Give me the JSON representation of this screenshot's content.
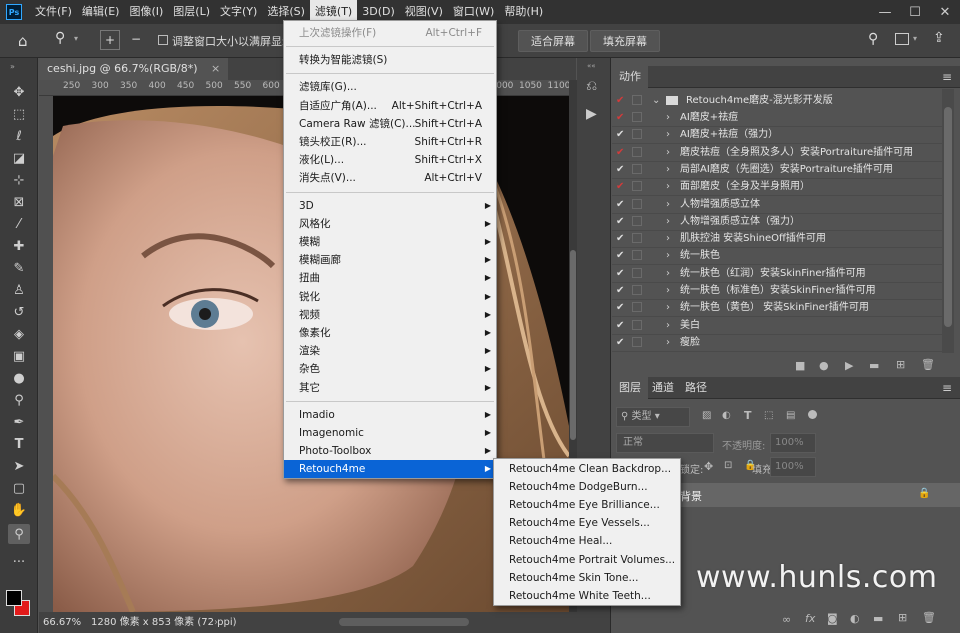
{
  "menubar": {
    "items": [
      "文件(F)",
      "编辑(E)",
      "图像(I)",
      "图层(L)",
      "文字(Y)",
      "选择(S)",
      "滤镜(T)",
      "3D(D)",
      "视图(V)",
      "窗口(W)",
      "帮助(H)"
    ],
    "active_index": 6
  },
  "window": {
    "min": "—",
    "max": "☐",
    "close": "✕"
  },
  "options": {
    "resize_label": "调整窗口大小以满屏显示",
    "fit_label": "适合屏幕",
    "fill_label": "填充屏幕"
  },
  "document": {
    "tab": "ceshi.jpg @ 66.7%(RGB/8*)",
    "close": "×"
  },
  "ruler": [
    "250",
    "300",
    "350",
    "400",
    "450",
    "500",
    "550",
    "600",
    "650",
    "700",
    "750",
    "800",
    "850",
    "900",
    "950",
    "1000",
    "1050",
    "1100"
  ],
  "status": {
    "zoom": "66.67%",
    "info": "1280 像素 x 853 像素 (72 ppi)"
  },
  "filter_menu": {
    "items": [
      {
        "label": "上次滤镜操作(F)",
        "shortcut": "Alt+Ctrl+F",
        "disabled": true
      },
      {
        "sep": true
      },
      {
        "label": "转换为智能滤镜(S)"
      },
      {
        "sep": true
      },
      {
        "label": "滤镜库(G)..."
      },
      {
        "label": "自适应广角(A)...",
        "shortcut": "Alt+Shift+Ctrl+A"
      },
      {
        "label": "Camera Raw 滤镜(C)...",
        "shortcut": "Shift+Ctrl+A"
      },
      {
        "label": "镜头校正(R)...",
        "shortcut": "Shift+Ctrl+R"
      },
      {
        "label": "液化(L)...",
        "shortcut": "Shift+Ctrl+X"
      },
      {
        "label": "消失点(V)...",
        "shortcut": "Alt+Ctrl+V"
      },
      {
        "sep": true
      },
      {
        "label": "3D",
        "arrow": true
      },
      {
        "label": "风格化",
        "arrow": true
      },
      {
        "label": "模糊",
        "arrow": true
      },
      {
        "label": "模糊画廊",
        "arrow": true
      },
      {
        "label": "扭曲",
        "arrow": true
      },
      {
        "label": "锐化",
        "arrow": true
      },
      {
        "label": "视频",
        "arrow": true
      },
      {
        "label": "像素化",
        "arrow": true
      },
      {
        "label": "渲染",
        "arrow": true
      },
      {
        "label": "杂色",
        "arrow": true
      },
      {
        "label": "其它",
        "arrow": true
      },
      {
        "sep": true
      },
      {
        "label": "Imadio",
        "arrow": true
      },
      {
        "label": "Imagenomic",
        "arrow": true
      },
      {
        "label": "Photo-Toolbox",
        "arrow": true
      },
      {
        "label": "Retouch4me",
        "arrow": true,
        "highlight": true
      }
    ]
  },
  "submenu": {
    "items": [
      "Retouch4me Clean Backdrop...",
      "Retouch4me DodgeBurn...",
      "Retouch4me Eye Brilliance...",
      "Retouch4me Eye Vessels...",
      "Retouch4me Heal...",
      "Retouch4me Portrait Volumes...",
      "Retouch4me Skin Tone...",
      "Retouch4me White Teeth..."
    ]
  },
  "actions": {
    "tab": "动作",
    "set": "Retouch4me磨皮-混光影开发版",
    "items": [
      {
        "label": "AI磨皮+祛痘",
        "red": true
      },
      {
        "label": "AI磨皮+祛痘（强力）",
        "red": false
      },
      {
        "label": "磨皮祛痘（全身照及多人）安装Portraiture插件可用",
        "red": true
      },
      {
        "label": "局部AI磨皮（先圈选）安装Portraiture插件可用",
        "red": false
      },
      {
        "label": "面部磨皮（全身及半身照用）",
        "red": true
      },
      {
        "label": "人物增强质感立体",
        "red": false
      },
      {
        "label": "人物增强质感立体（强力）",
        "red": false
      },
      {
        "label": "肌肤控油 安装ShineOff插件可用",
        "red": false
      },
      {
        "label": "统一肤色",
        "red": false
      },
      {
        "label": "统一肤色（红润）安装SkinFiner插件可用",
        "red": false
      },
      {
        "label": "统一肤色（标准色）安装SkinFiner插件可用",
        "red": false
      },
      {
        "label": "统一肤色（黄色） 安装SkinFiner插件可用",
        "red": false
      },
      {
        "label": "美白",
        "red": false
      },
      {
        "label": "瘦脸",
        "red": false
      }
    ]
  },
  "layers": {
    "tabs": [
      "图层",
      "通道",
      "路径"
    ],
    "kind": "类型",
    "blend": "正常",
    "opacity_label": "不透明度:",
    "opacity": "100%",
    "lock_label": "锁定:",
    "fill_label": "填充:",
    "fill": "100%",
    "bg_label": "背景"
  },
  "watermark": "www.hunls.com"
}
